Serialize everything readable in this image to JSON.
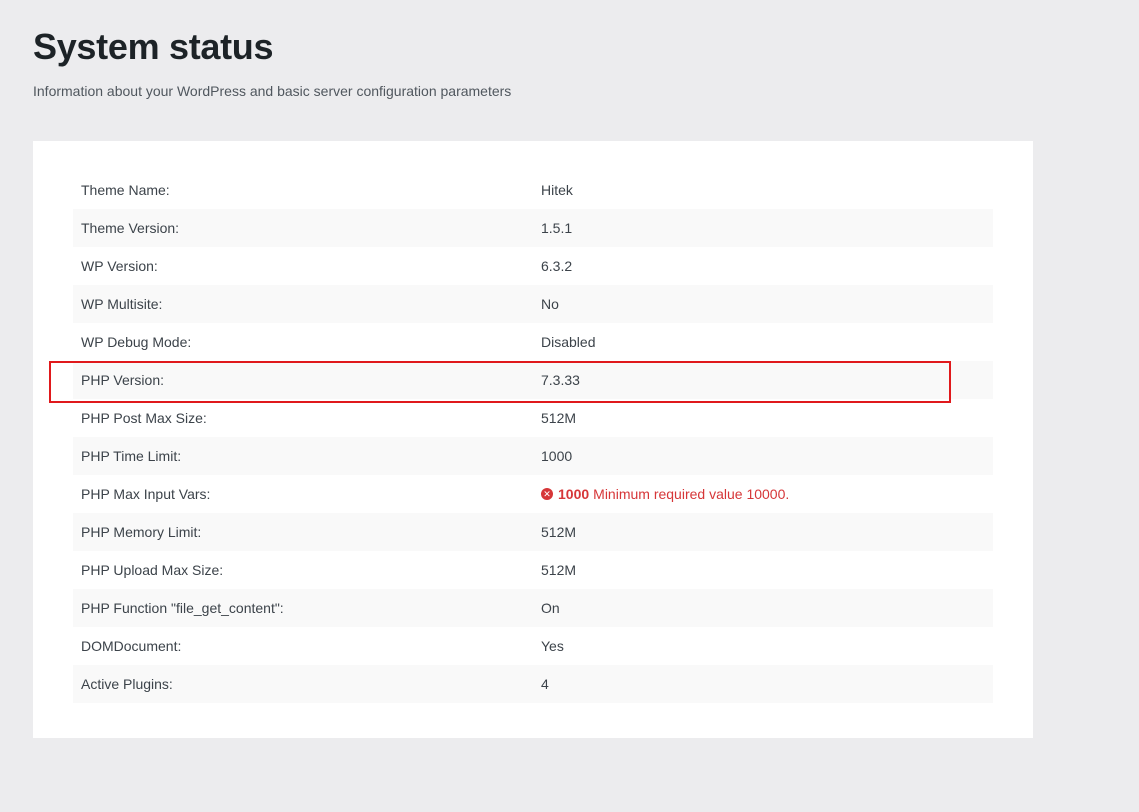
{
  "header": {
    "title": "System status",
    "subtitle": "Information about your WordPress and basic server configuration parameters"
  },
  "status": {
    "rows": [
      {
        "label": "Theme Name:",
        "value": "Hitek"
      },
      {
        "label": "Theme Version:",
        "value": "1.5.1"
      },
      {
        "label": "WP Version:",
        "value": "6.3.2"
      },
      {
        "label": "WP Multisite:",
        "value": "No"
      },
      {
        "label": "WP Debug Mode:",
        "value": "Disabled"
      },
      {
        "label": "PHP Version:",
        "value": "7.3.33"
      },
      {
        "label": "PHP Post Max Size:",
        "value": "512M"
      },
      {
        "label": "PHP Time Limit:",
        "value": "1000"
      },
      {
        "label": "PHP Max Input Vars:",
        "value": "1000",
        "message": "Minimum required value 10000."
      },
      {
        "label": "PHP Memory Limit:",
        "value": "512M"
      },
      {
        "label": "PHP Upload Max Size:",
        "value": "512M"
      },
      {
        "label": "PHP Function \"file_get_content\":",
        "value": "On"
      },
      {
        "label": "DOMDocument:",
        "value": "Yes"
      },
      {
        "label": "Active Plugins:",
        "value": "4"
      }
    ],
    "error_icon": "x-circle-icon",
    "error_color": "#d63638"
  },
  "highlight": {
    "row_label": "PHP Version:",
    "color": "#e0191c"
  }
}
